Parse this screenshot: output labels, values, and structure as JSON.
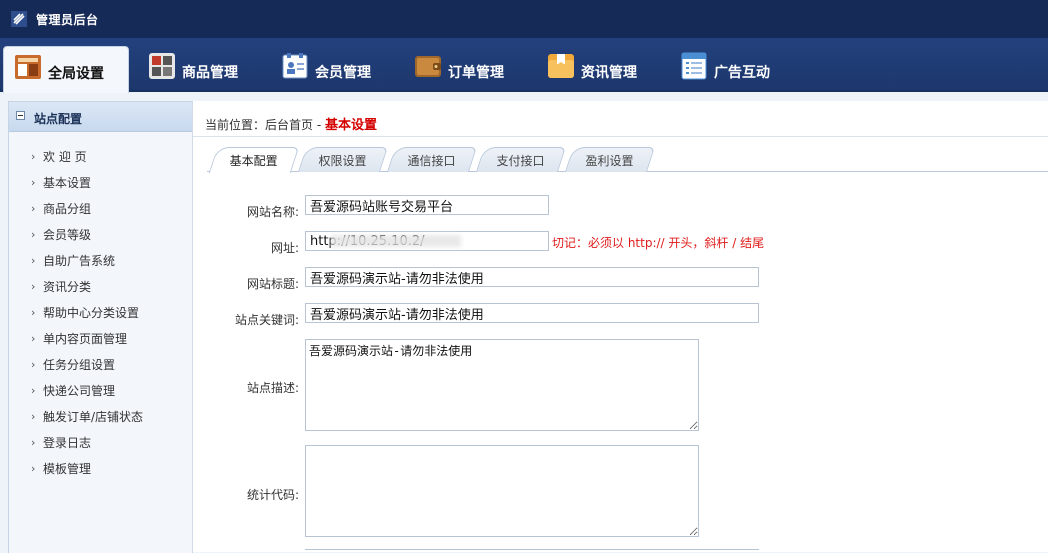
{
  "app": {
    "title": "管理员后台"
  },
  "nav": {
    "items": [
      {
        "label": "全局设置",
        "icon": "settings-board-icon",
        "active": true
      },
      {
        "label": "商品管理",
        "icon": "product-grid-icon"
      },
      {
        "label": "会员管理",
        "icon": "member-card-icon"
      },
      {
        "label": "订单管理",
        "icon": "wallet-icon"
      },
      {
        "label": "资讯管理",
        "icon": "folder-icon"
      },
      {
        "label": "广告互动",
        "icon": "document-list-icon"
      }
    ]
  },
  "sidebar": {
    "title": "站点配置",
    "items": [
      {
        "label": "欢 迎 页"
      },
      {
        "label": "基本设置"
      },
      {
        "label": "商品分组"
      },
      {
        "label": "会员等级"
      },
      {
        "label": "自助广告系统"
      },
      {
        "label": "资讯分类"
      },
      {
        "label": "帮助中心分类设置"
      },
      {
        "label": "单内容页面管理"
      },
      {
        "label": "任务分组设置"
      },
      {
        "label": "快递公司管理"
      },
      {
        "label": "触发订单/店铺状态"
      },
      {
        "label": "登录日志"
      },
      {
        "label": "模板管理"
      }
    ]
  },
  "breadcrumb": {
    "prefix": "当前位置：",
    "home": "后台首页",
    "sep": " - ",
    "current": "基本设置"
  },
  "tabs": [
    {
      "label": "基本配置",
      "active": true
    },
    {
      "label": "权限设置"
    },
    {
      "label": "通信接口"
    },
    {
      "label": "支付接口"
    },
    {
      "label": "盈利设置"
    }
  ],
  "form": {
    "site_name": {
      "label": "网站名称:",
      "value": "吾爱源码站账号交易平台"
    },
    "url": {
      "label": "网址:",
      "value": "http://10.25.10.2/",
      "hint": "切记：必须以 http:// 开头，斜杆 / 结尾"
    },
    "site_title": {
      "label": "网站标题:",
      "value": "吾爱源码演示站-请勿非法使用"
    },
    "keywords": {
      "label": "站点关键词:",
      "value": "吾爱源码演示站-请勿非法使用"
    },
    "description": {
      "label": "站点描述:",
      "value": "吾爱源码演示站-请勿非法使用"
    },
    "stats_code": {
      "label": "统计代码:",
      "value": ""
    }
  },
  "colors": {
    "header": "#152a57",
    "nav": "#23417e",
    "accent_red": "#d40000",
    "hint_red": "#e01b1b"
  }
}
